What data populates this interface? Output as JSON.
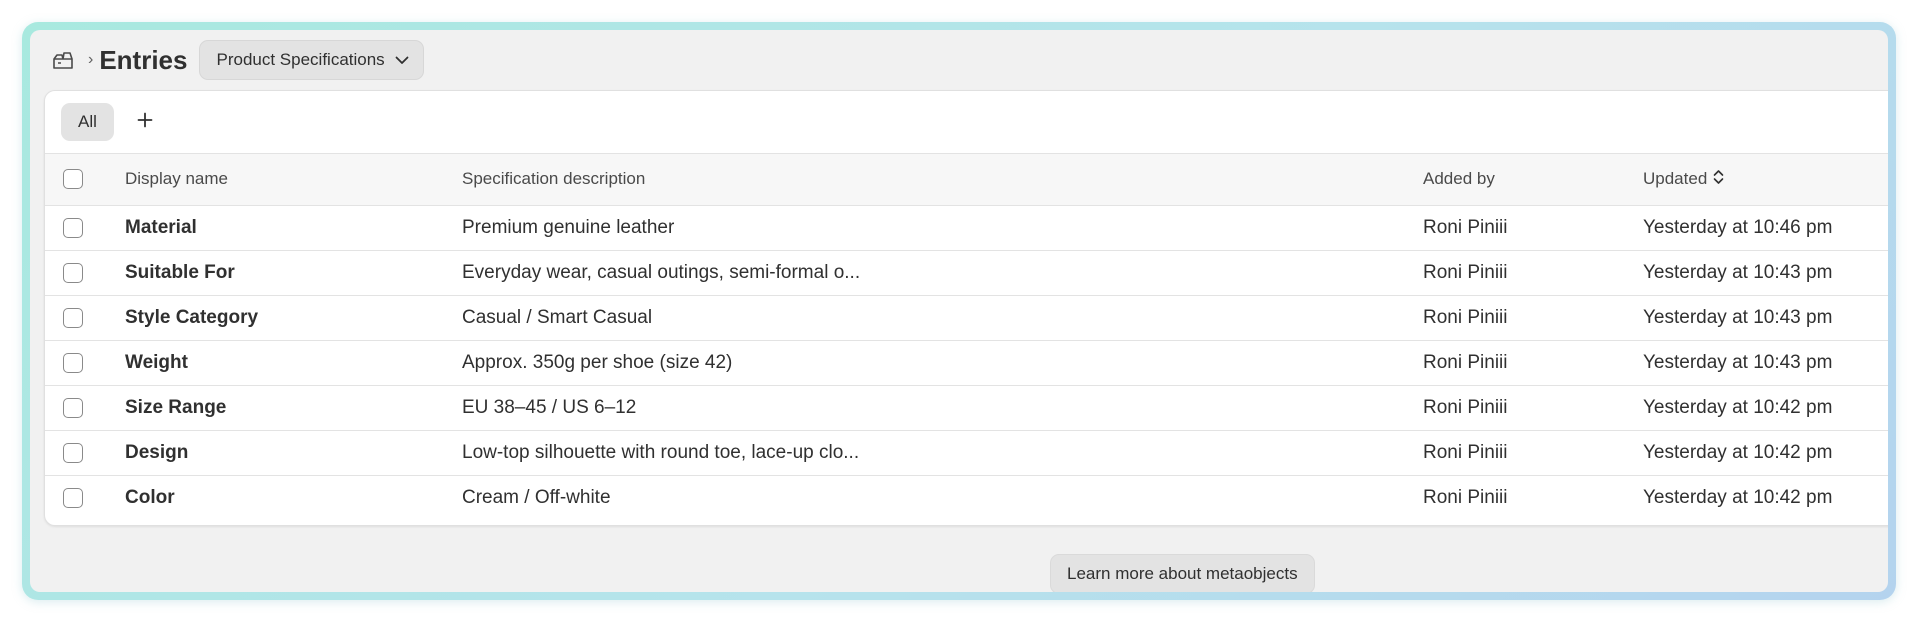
{
  "header": {
    "store_icon": "store-icon",
    "title": "Entries",
    "selector_label": "Product Specifications"
  },
  "tabs": [
    {
      "label": "All",
      "selected": true
    }
  ],
  "table": {
    "columns": {
      "name": "Display name",
      "description": "Specification description",
      "added_by": "Added by",
      "updated": "Updated"
    },
    "rows": [
      {
        "name": "Material",
        "description": "Premium genuine leather",
        "added_by": "Roni Piniii",
        "updated": "Yesterday at 10:46 pm"
      },
      {
        "name": "Suitable For",
        "description": "Everyday wear, casual outings, semi-formal o...",
        "added_by": "Roni Piniii",
        "updated": "Yesterday at 10:43 pm"
      },
      {
        "name": "Style Category",
        "description": "Casual / Smart Casual",
        "added_by": "Roni Piniii",
        "updated": "Yesterday at 10:43 pm"
      },
      {
        "name": "Weight",
        "description": "Approx. 350g per shoe (size 42)",
        "added_by": "Roni Piniii",
        "updated": "Yesterday at 10:43 pm"
      },
      {
        "name": "Size Range",
        "description": "EU 38–45 / US 6–12",
        "added_by": "Roni Piniii",
        "updated": "Yesterday at 10:42 pm"
      },
      {
        "name": "Design",
        "description": "Low-top silhouette with round toe, lace-up clo...",
        "added_by": "Roni Piniii",
        "updated": "Yesterday at 10:42 pm"
      },
      {
        "name": "Color",
        "description": "Cream / Off-white",
        "added_by": "Roni Piniii",
        "updated": "Yesterday at 10:42 pm"
      }
    ]
  },
  "footer": {
    "learn_more_label": "Learn more about metaobjects"
  }
}
